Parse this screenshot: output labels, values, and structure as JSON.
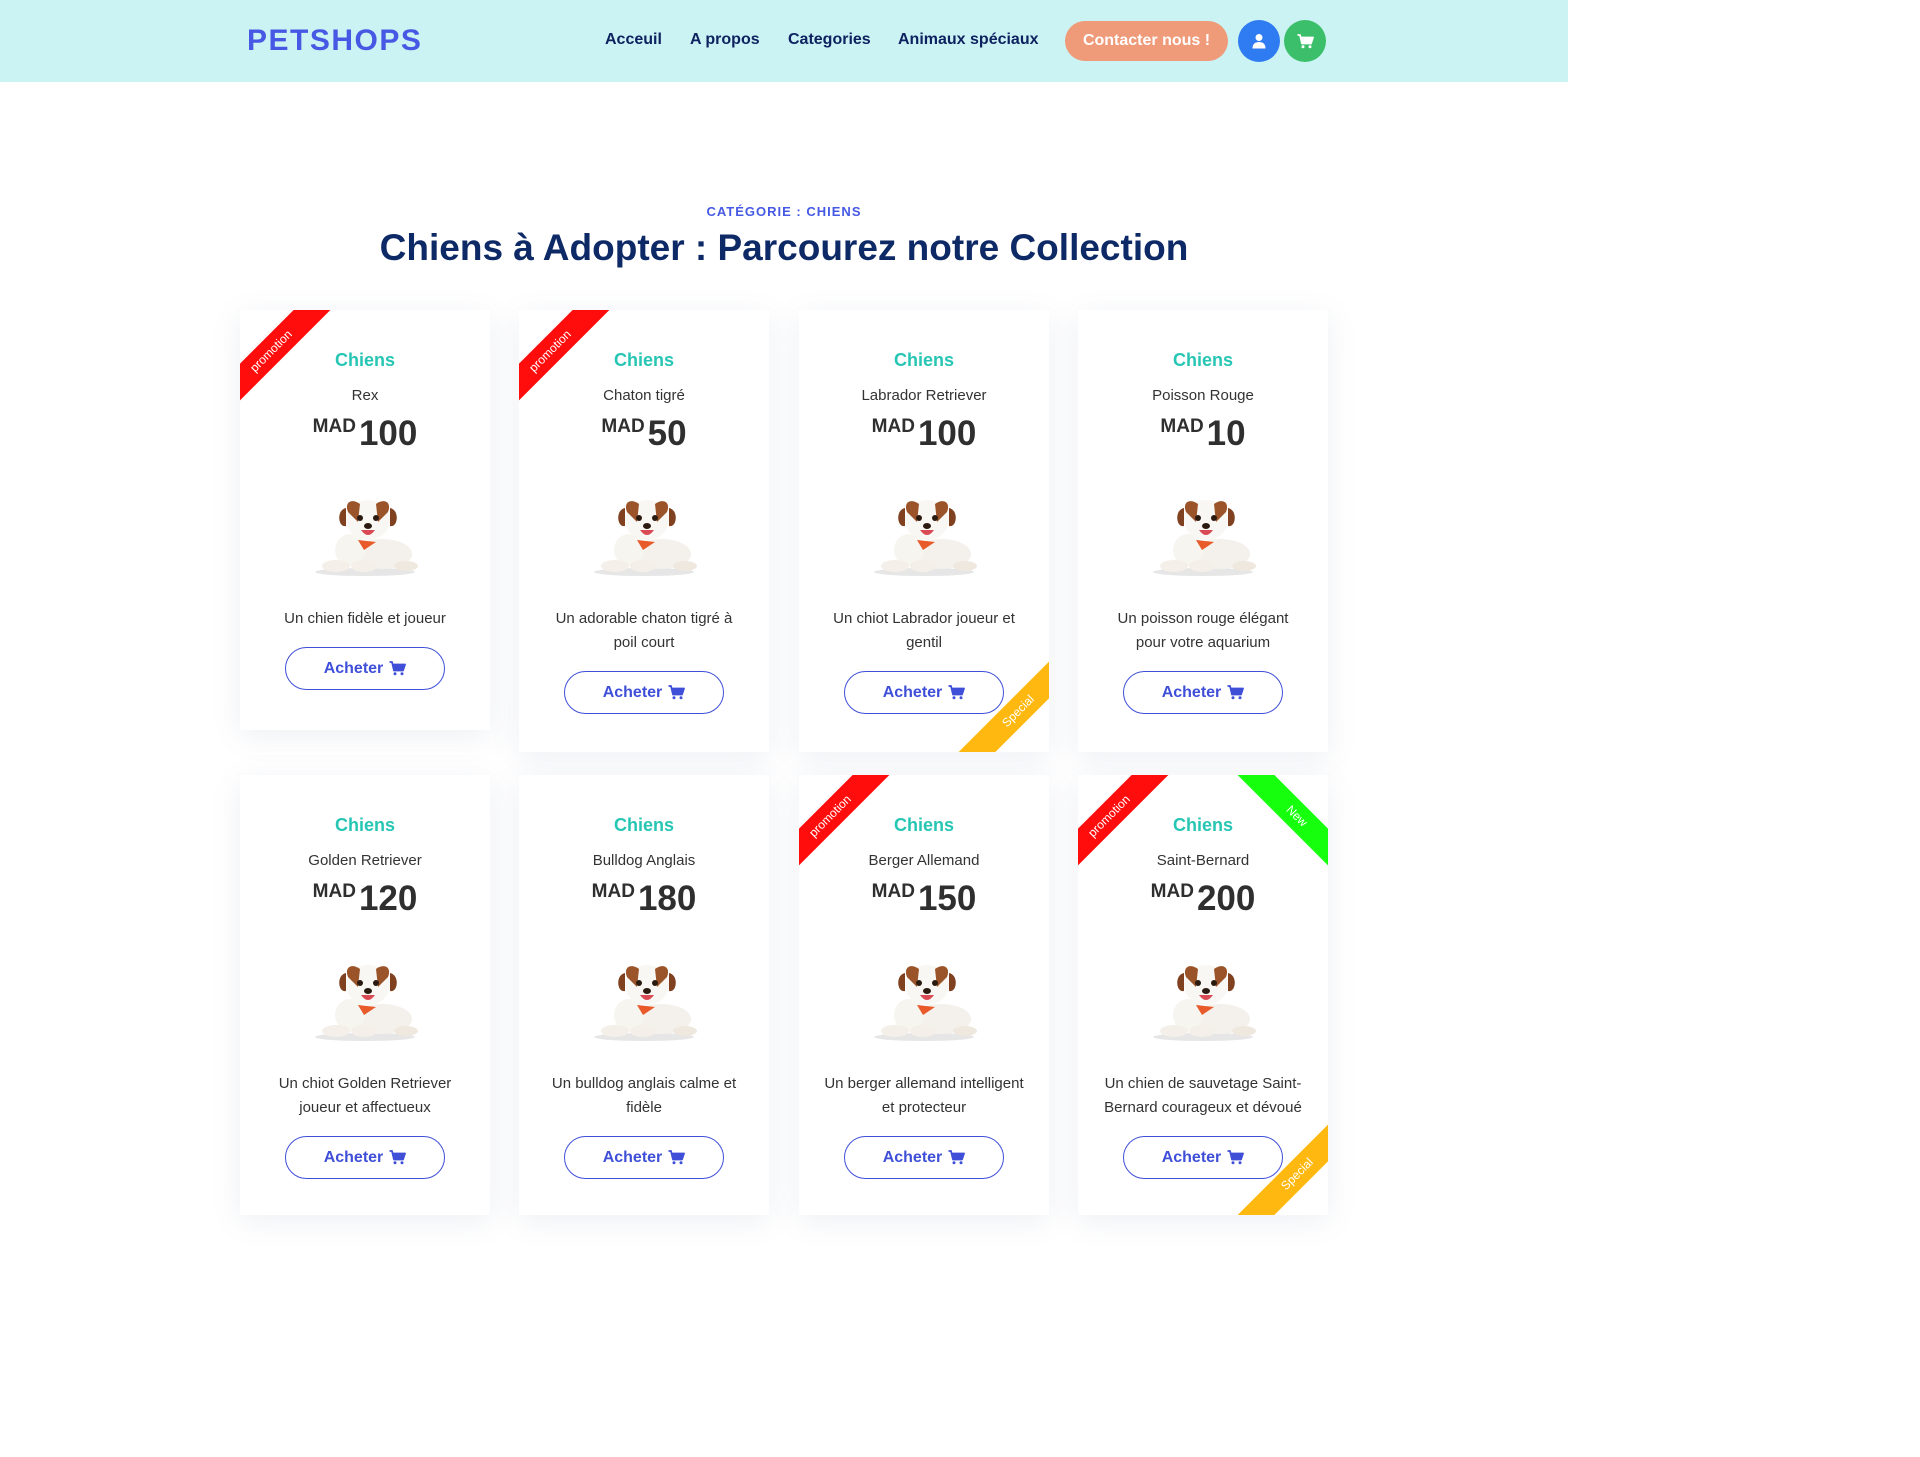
{
  "header": {
    "logo": "PETSHOPS",
    "nav": [
      {
        "label": "Acceuil"
      },
      {
        "label": "A propos"
      },
      {
        "label": "Categories"
      },
      {
        "label": "Animaux spéciaux"
      }
    ],
    "contact_label": "Contacter nous !",
    "user_icon": "user-icon",
    "cart_icon": "cart-icon"
  },
  "section": {
    "label": "CATÉGORIE : CHIENS",
    "title": "Chiens à Adopter : Parcourez notre Collection"
  },
  "currency": "MAD",
  "buy_label": "Acheter",
  "colors": {
    "promotion": "#ff0d0d",
    "new": "#16ff0c",
    "special": "#ffb810",
    "category": "#27c6b4",
    "accent": "#4659e4"
  },
  "products": [
    {
      "category": "Chiens",
      "name": "Rex",
      "price": "100",
      "description": "Un chien fidèle et joueur",
      "ribbons": [
        {
          "pos": "tl",
          "text": "promotion",
          "color": "red"
        }
      ]
    },
    {
      "category": "Chiens",
      "name": "Chaton tigré",
      "price": "50",
      "description": "Un adorable chaton tigré à poil court",
      "ribbons": [
        {
          "pos": "tl",
          "text": "promotion",
          "color": "red"
        }
      ]
    },
    {
      "category": "Chiens",
      "name": "Labrador Retriever",
      "price": "100",
      "description": "Un chiot Labrador joueur et gentil",
      "ribbons": [
        {
          "pos": "br",
          "text": "Special",
          "color": "orange"
        }
      ]
    },
    {
      "category": "Chiens",
      "name": "Poisson Rouge",
      "price": "10",
      "description": "Un poisson rouge élégant pour votre aquarium",
      "ribbons": []
    },
    {
      "category": "Chiens",
      "name": "Golden Retriever",
      "price": "120",
      "description": "Un chiot Golden Retriever joueur et affectueux",
      "ribbons": []
    },
    {
      "category": "Chiens",
      "name": "Bulldog Anglais",
      "price": "180",
      "description": "Un bulldog anglais calme et fidèle",
      "ribbons": []
    },
    {
      "category": "Chiens",
      "name": "Berger Allemand",
      "price": "150",
      "description": "Un berger allemand intelligent et protecteur",
      "ribbons": [
        {
          "pos": "tl",
          "text": "promotion",
          "color": "red"
        }
      ]
    },
    {
      "category": "Chiens",
      "name": "Saint-Bernard",
      "price": "200",
      "description": "Un chien de sauvetage Saint-Bernard courageux et dévoué",
      "ribbons": [
        {
          "pos": "tl",
          "text": "promotion",
          "color": "red"
        },
        {
          "pos": "tr",
          "text": "New",
          "color": "green"
        },
        {
          "pos": "br",
          "text": "Special",
          "color": "orange"
        }
      ]
    }
  ]
}
